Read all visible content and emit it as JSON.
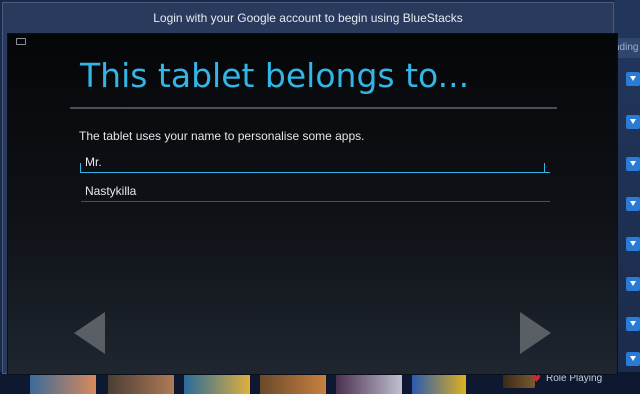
{
  "dialog": {
    "title": "Login with your Google account to begin using BlueStacks"
  },
  "setup": {
    "heading": "This tablet belongs to...",
    "subtitle": "The tablet uses your name to personalise some apps.",
    "first_name_value": "Mr.",
    "last_name_value": "Nastykilla"
  },
  "background": {
    "tab_label": "nding",
    "category_label": "Role Playing"
  },
  "icons": {
    "keyboard": "keyboard-icon",
    "prev": "chevron-left-icon",
    "next": "chevron-right-icon",
    "download": "download-icon"
  },
  "colors": {
    "accent": "#33b5e5",
    "dialog_frame": "#2a3a5c"
  }
}
